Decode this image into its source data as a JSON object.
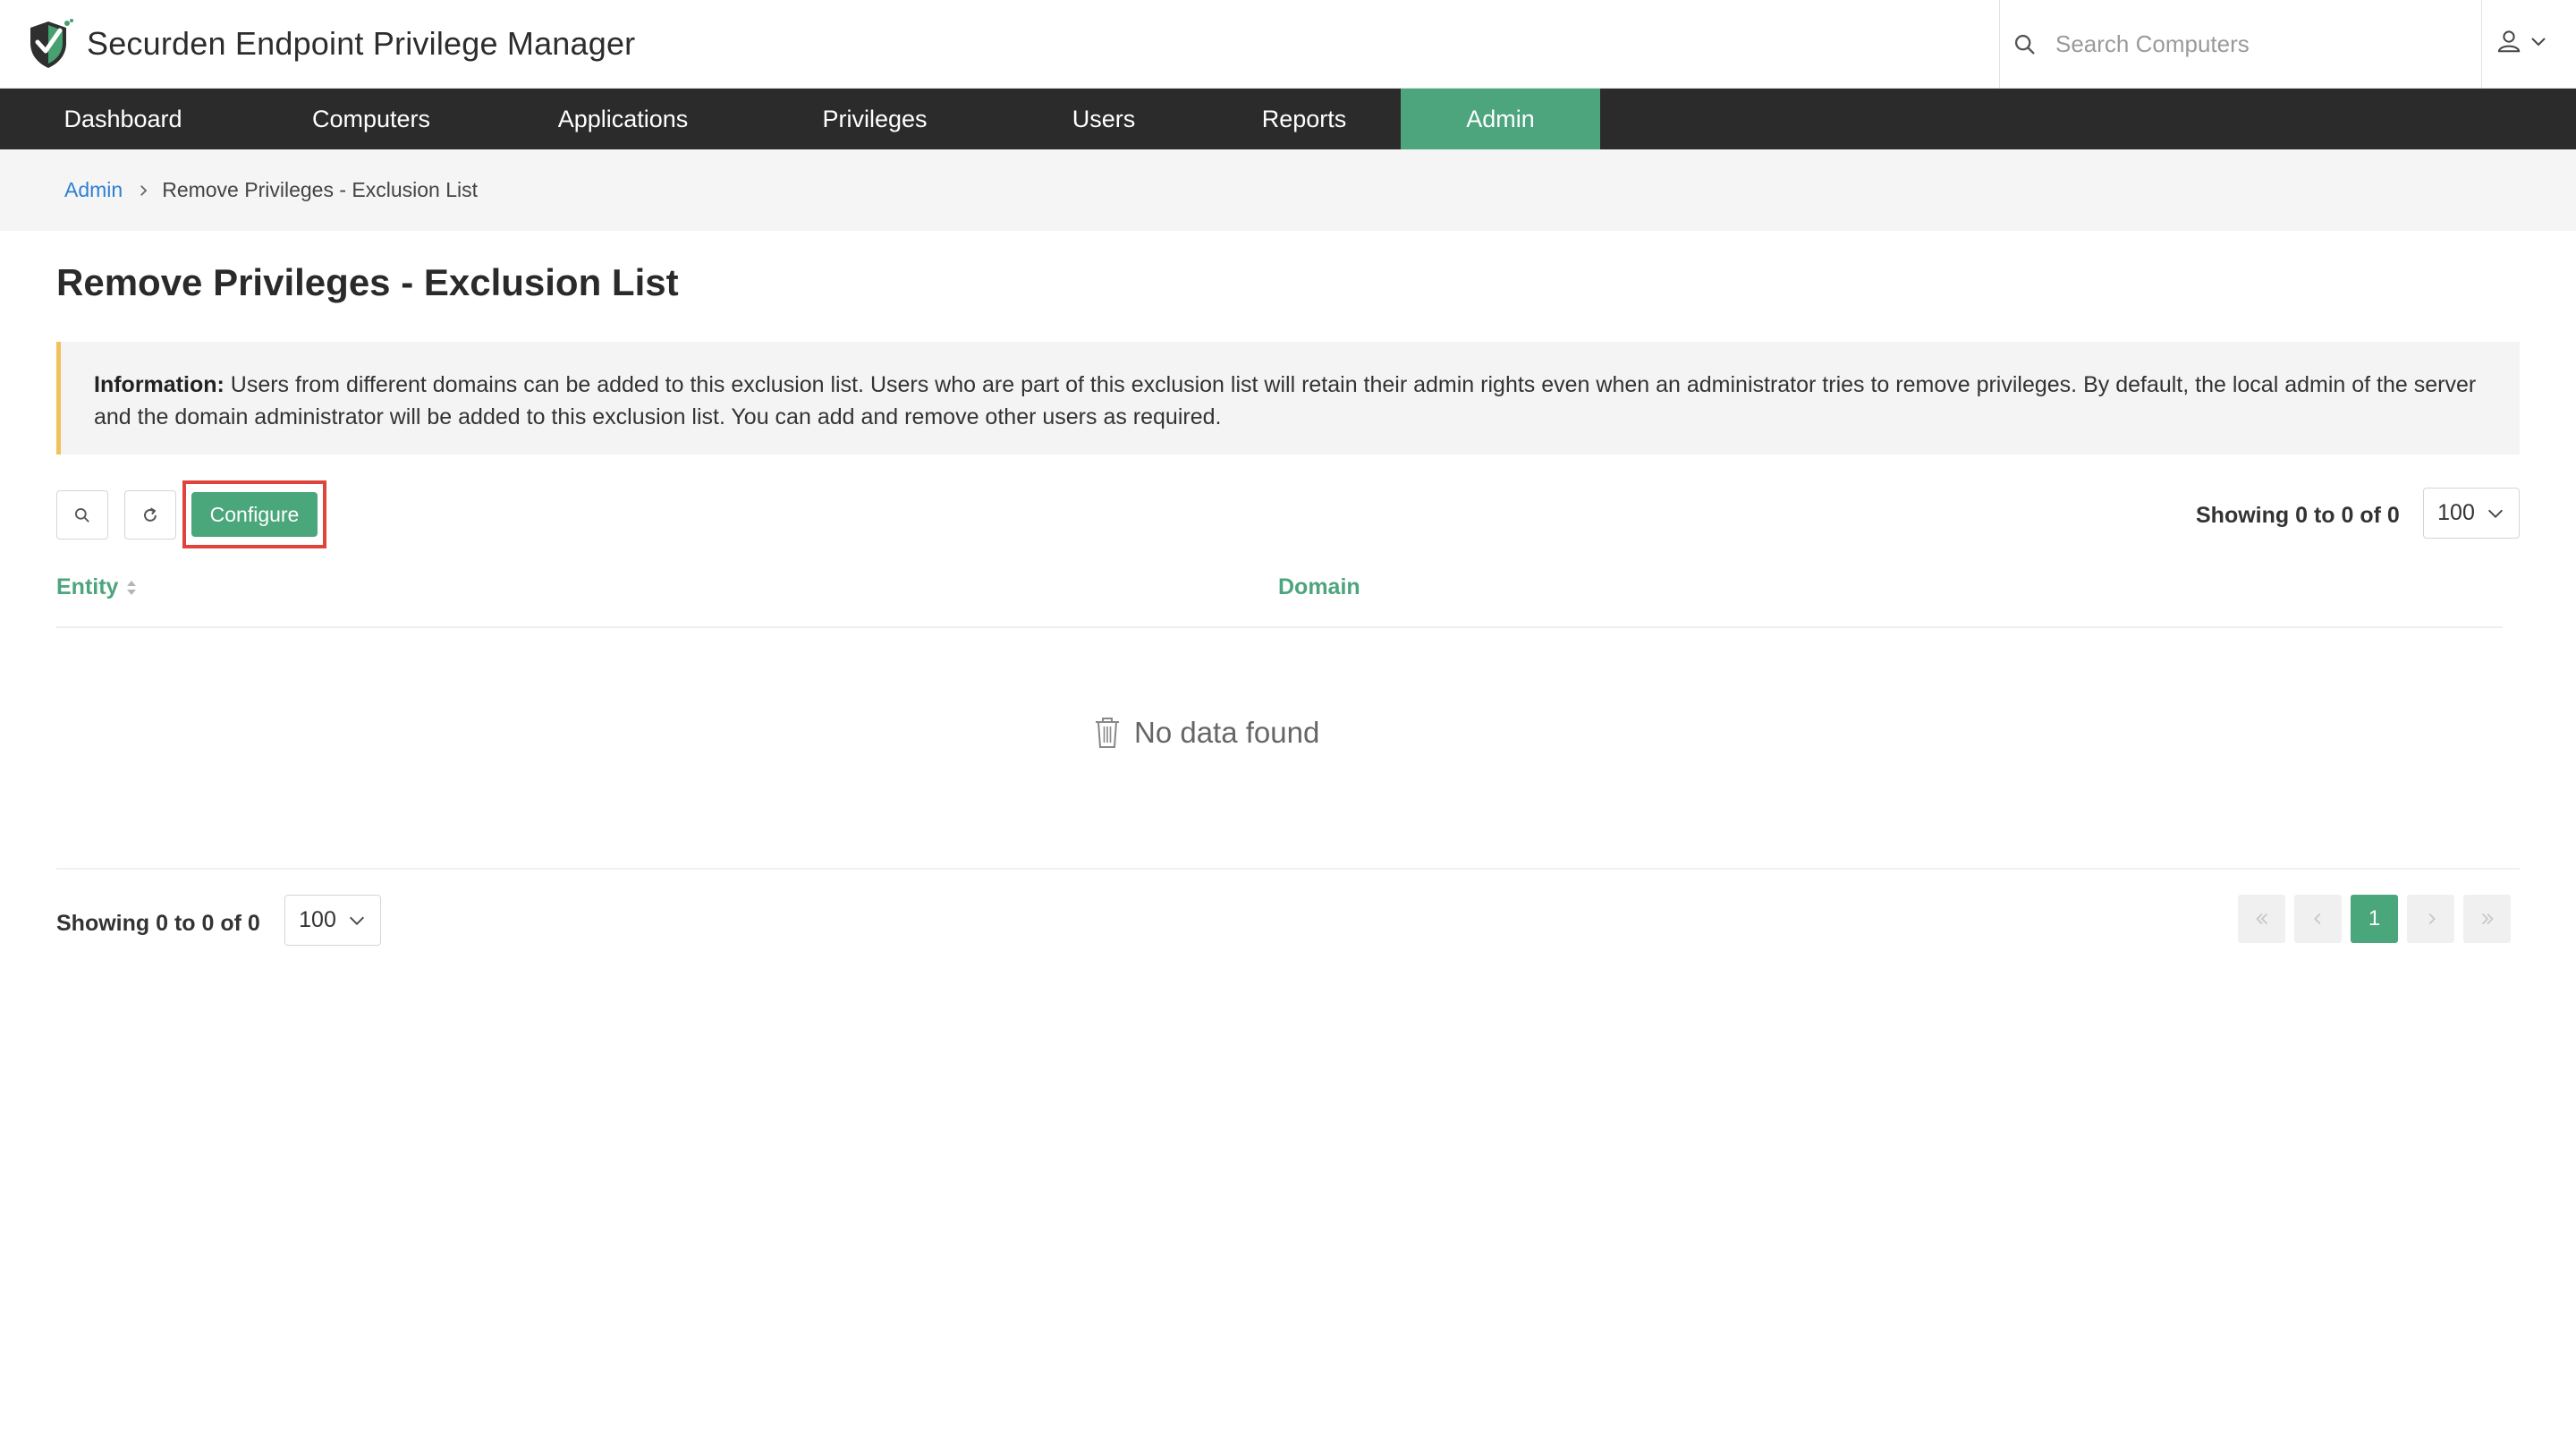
{
  "app": {
    "title": "Securden Endpoint Privilege Manager",
    "brand_color": "#4da57d"
  },
  "search": {
    "placeholder": "Search Computers",
    "value": ""
  },
  "nav": {
    "items": [
      {
        "label": "Dashboard"
      },
      {
        "label": "Computers"
      },
      {
        "label": "Applications"
      },
      {
        "label": "Privileges"
      },
      {
        "label": "Users"
      },
      {
        "label": "Reports"
      },
      {
        "label": "Admin"
      }
    ],
    "active": "Admin"
  },
  "breadcrumb": {
    "parent": "Admin",
    "current": "Remove Privileges - Exclusion List"
  },
  "page": {
    "title": "Remove Privileges - Exclusion List"
  },
  "info": {
    "label": "Information:",
    "text": " Users from different domains can be added to this exclusion list. Users who are part of this exclusion list will retain their admin rights even when an administrator tries to remove privileges. By default, the local admin of the server and the domain administrator will be added to this exclusion list. You can add and remove other users as required."
  },
  "toolbar": {
    "search_icon": "search-icon",
    "refresh_icon": "refresh-icon",
    "configure_label": "Configure",
    "showing_text": "Showing 0 to 0 of 0",
    "page_size": "100"
  },
  "table": {
    "columns": [
      {
        "label": "Entity",
        "sortable": true
      },
      {
        "label": "Domain",
        "sortable": false
      }
    ],
    "rows": [],
    "empty_text": "No data found"
  },
  "footer": {
    "showing_text": "Showing 0 to 0 of 0",
    "page_size": "100",
    "current_page": "1"
  }
}
